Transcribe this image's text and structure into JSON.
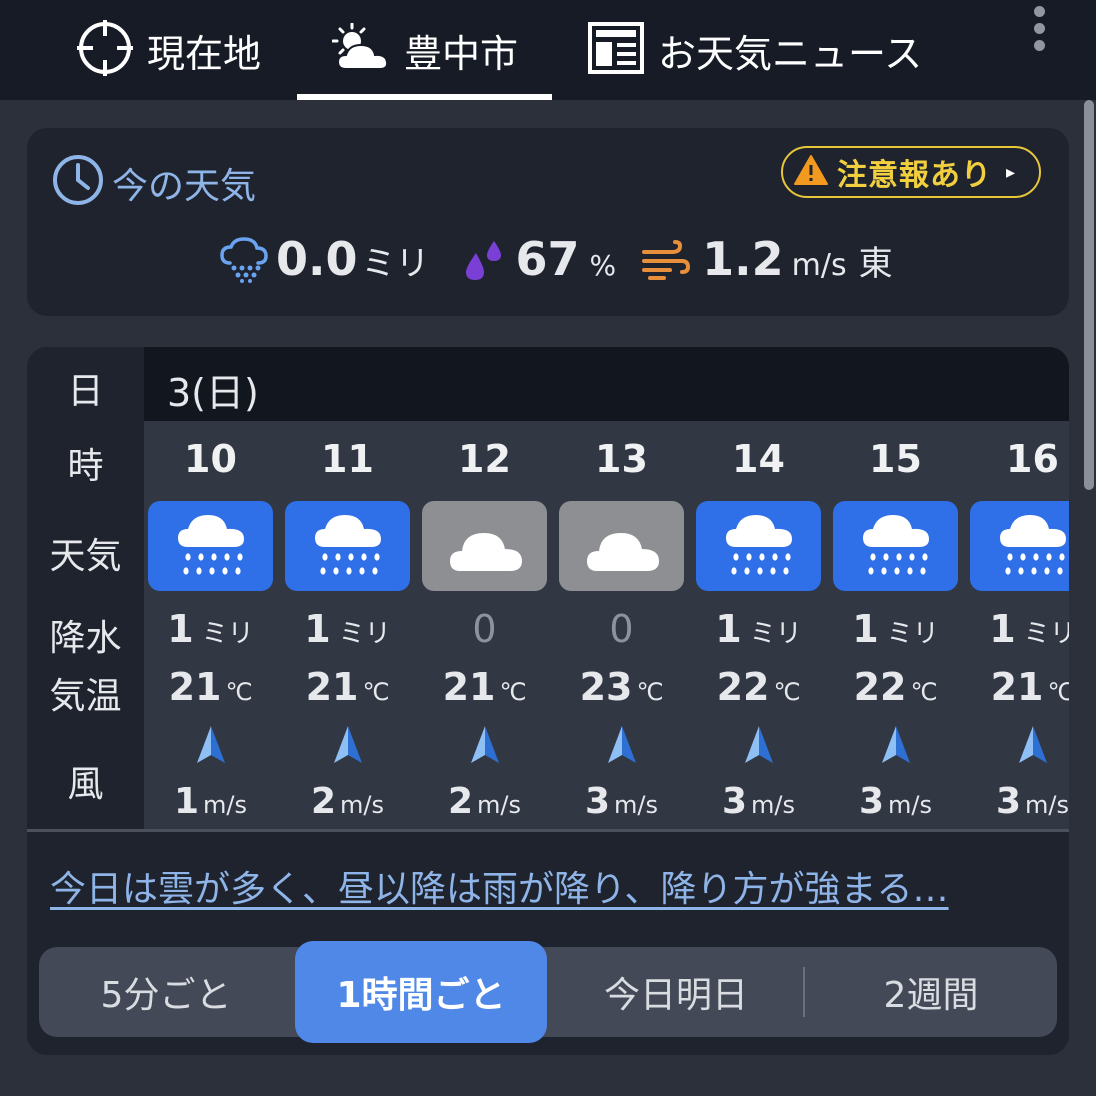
{
  "tabs": [
    {
      "label": "現在地",
      "icon": "crosshair-icon"
    },
    {
      "label": "豊中市",
      "icon": "partly-cloudy-icon",
      "selected": true
    },
    {
      "label": "お天気ニュース",
      "icon": "newspaper-icon"
    }
  ],
  "current": {
    "title": "今の天気",
    "alert_label": "注意報あり",
    "precip_value": "0.0",
    "precip_unit": "ミリ",
    "humidity_value": "67",
    "humidity_unit": "%",
    "wind_value": "1.2",
    "wind_unit": "m/s",
    "wind_dir": "東"
  },
  "hourly": {
    "day_row_label": "日",
    "hour_row_label": "時",
    "weather_row_label": "天気",
    "precip_row_label": "降水",
    "temp_row_label": "気温",
    "wind_row_label": "風",
    "day": "3(日)",
    "precip_unit": "ミリ",
    "temp_unit": "℃",
    "wind_unit": "m/s",
    "hours": [
      {
        "hour": "10",
        "weather": "rain",
        "precip": "1",
        "temp": "21",
        "wind": "1"
      },
      {
        "hour": "11",
        "weather": "rain",
        "precip": "1",
        "temp": "21",
        "wind": "2"
      },
      {
        "hour": "12",
        "weather": "cloud",
        "precip": "0",
        "temp": "21",
        "wind": "2"
      },
      {
        "hour": "13",
        "weather": "cloud",
        "precip": "0",
        "temp": "23",
        "wind": "3"
      },
      {
        "hour": "14",
        "weather": "rain",
        "precip": "1",
        "temp": "22",
        "wind": "3"
      },
      {
        "hour": "15",
        "weather": "rain",
        "precip": "1",
        "temp": "22",
        "wind": "3"
      },
      {
        "hour": "16",
        "weather": "rain",
        "precip": "1",
        "temp": "21",
        "wind": "3"
      }
    ]
  },
  "forecast_text": "今日は雲が多く、昼以降は雨が降り、降り方が強まる…",
  "segments": [
    "5分ごと",
    "1時間ごと",
    "今日明日",
    "2週間"
  ],
  "colors": {
    "rain_box": "#2f6fe8",
    "cloud_box": "#8d8f92",
    "accent": "#4f88e6",
    "alert": "#e8c63a"
  }
}
